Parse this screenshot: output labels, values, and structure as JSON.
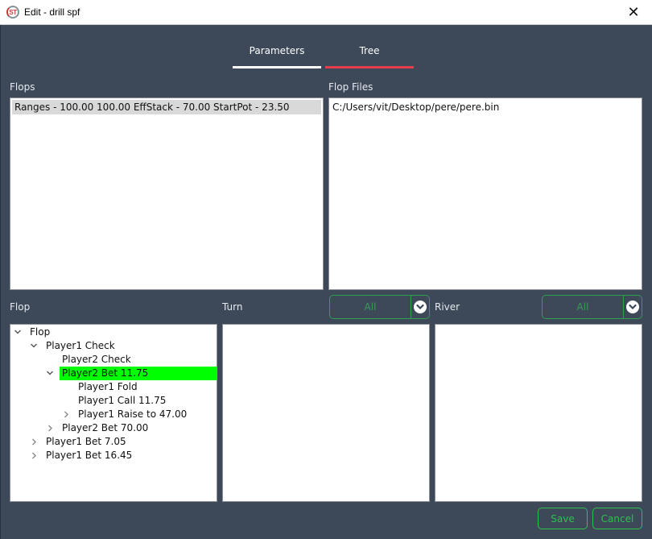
{
  "window": {
    "title": "Edit - drill spf",
    "icon_text": "ST",
    "close_glyph": "✕"
  },
  "tabs": [
    {
      "label": "Parameters",
      "underline_color": "#ffffff"
    },
    {
      "label": "Tree",
      "underline_color": "#e83c4b",
      "active": true
    }
  ],
  "flops": {
    "label": "Flops",
    "items": [
      {
        "text": "Ranges - 100.00 100.00 EffStack - 70.00 StartPot - 23.50",
        "selected": true
      }
    ]
  },
  "flop_files": {
    "label": "Flop Files",
    "items": [
      {
        "text": "C:/Users/vit/Desktop/pere/pere.bin"
      }
    ]
  },
  "flop_tree": {
    "label": "Flop",
    "nodes": [
      {
        "text": "Flop",
        "depth": 0,
        "expander": "expanded"
      },
      {
        "text": "Player1 Check",
        "depth": 1,
        "expander": "expanded"
      },
      {
        "text": "Player2 Check",
        "depth": 2,
        "expander": "none"
      },
      {
        "text": "Player2 Bet 11.75",
        "depth": 2,
        "expander": "expanded",
        "highlighted": true
      },
      {
        "text": "Player1 Fold",
        "depth": 3,
        "expander": "none"
      },
      {
        "text": "Player1 Call 11.75",
        "depth": 3,
        "expander": "none"
      },
      {
        "text": "Player1 Raise to 47.00",
        "depth": 3,
        "expander": "collapsed"
      },
      {
        "text": "Player2 Bet 70.00",
        "depth": 2,
        "expander": "collapsed"
      },
      {
        "text": "Player1 Bet 7.05",
        "depth": 1,
        "expander": "collapsed"
      },
      {
        "text": "Player1 Bet 16.45",
        "depth": 1,
        "expander": "collapsed"
      }
    ],
    "highlight_color": "#00ff00"
  },
  "turn": {
    "label": "Turn",
    "filter": {
      "value": "All",
      "icon": "chevron-down-circle"
    }
  },
  "river": {
    "label": "River",
    "filter": {
      "value": "All",
      "icon": "chevron-down-circle"
    }
  },
  "buttons": {
    "save": "Save",
    "cancel": "Cancel"
  },
  "colors": {
    "background": "#3d4859",
    "accent_green": "#2ec14e",
    "tab_active": "#e83c4b"
  }
}
